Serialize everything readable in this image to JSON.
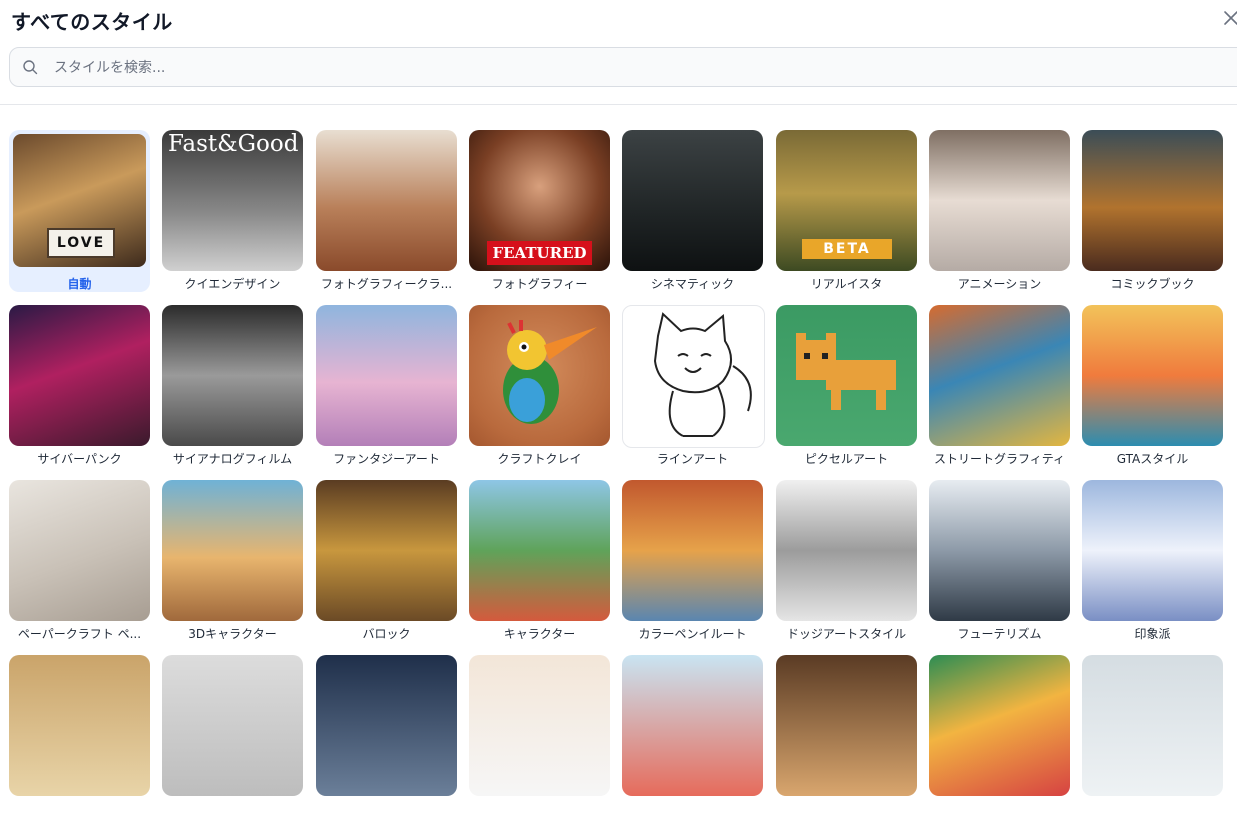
{
  "title": "すべてのスタイル",
  "search": {
    "placeholder": "スタイルを検索..."
  },
  "styles": [
    {
      "label": "自動",
      "selected": true,
      "bg": "linear-gradient(160deg,#6b4a2d 0%,#c99a5b 45%,#3d2a1c 100%)",
      "overlay": "LOVE"
    },
    {
      "label": "クイエンデザイン",
      "bg": "linear-gradient(180deg,#3a3a3a 0%,#8b8b8b 60%,#d0d0d0 100%)",
      "overlay": "Fast&Good"
    },
    {
      "label": "フォトグラフィークラ...",
      "bg": "linear-gradient(180deg,#e8ded1 0%,#b9805a 55%,#8a4a2b 100%)"
    },
    {
      "label": "フォトグラフィー",
      "bg": "radial-gradient(circle at 50% 40%,#d8a07d 0%,#7a3f24 55%,#2a1209 100%)",
      "overlay": "FEATURED"
    },
    {
      "label": "シネマティック",
      "bg": "linear-gradient(180deg,#3c4244 0%,#1f2425 60%,#0e1112 100%)"
    },
    {
      "label": "リアルイスタ",
      "bg": "linear-gradient(180deg,#7a6a36 0%,#b79a4a 45%,#3d4a22 100%)",
      "overlay": "BETA"
    },
    {
      "label": "アニメーション",
      "bg": "linear-gradient(180deg,#7f6f63 0%,#e7dcd3 50%,#b5aba5 100%)"
    },
    {
      "label": "コミックブック",
      "bg": "linear-gradient(180deg,#3b4d57 0%,#b1732e 55%,#4a2b1e 100%)"
    },
    {
      "label": "サイバーパンク",
      "bg": "linear-gradient(160deg,#2a1a45 0%,#b02060 45%,#3a1a2c 100%)"
    },
    {
      "label": "サイアナログフィルム",
      "bg": "linear-gradient(180deg,#2b2b2b 0%,#9a9a9a 50%,#4a4a4a 100%)"
    },
    {
      "label": "ファンタジーアート",
      "bg": "linear-gradient(180deg,#8fb5de 0%,#e7b4d2 55%,#b37fb8 100%)"
    },
    {
      "label": "クラフトクレイ",
      "bg": "radial-gradient(circle at 50% 45%,#d38c5c 0%,#b96a3d 70%,#a4572f 100%)"
    },
    {
      "label": "ラインアート",
      "bg": "#ffffff",
      "border": true
    },
    {
      "label": "ピクセルアート",
      "bg": "linear-gradient(180deg,#3b9a63 0%,#4aa86f 100%)"
    },
    {
      "label": "ストリートグラフィティ",
      "bg": "linear-gradient(160deg,#d66b2f 0%,#3a86b5 45%,#e3b640 100%)"
    },
    {
      "label": "GTAスタイル",
      "bg": "linear-gradient(180deg,#f2c35a 0%,#f07b3d 50%,#2c8db0 100%)"
    },
    {
      "label": "ペーパークラフト ペ...",
      "bg": "linear-gradient(160deg,#e9e5df 0%,#c9c1b7 55%,#a79d92 100%)"
    },
    {
      "label": "3Dキャラクター",
      "bg": "linear-gradient(180deg,#6fb2d6 0%,#e8b56e 55%,#a0693c 100%)"
    },
    {
      "label": "バロック",
      "bg": "linear-gradient(180deg,#5a3c22 0%,#c8973e 50%,#6b4a26 100%)"
    },
    {
      "label": "キャラクター",
      "bg": "linear-gradient(180deg,#8ec6e6 0%,#5fa35a 50%,#d45a3d 100%)"
    },
    {
      "label": "カラーペンイルート",
      "bg": "linear-gradient(180deg,#c1582e 0%,#e6a24a 50%,#5a86b0 100%)"
    },
    {
      "label": "ドッジアートスタイル",
      "bg": "linear-gradient(180deg,#f0f0f0 0%,#9c9c9c 50%,#e5e5e5 100%)"
    },
    {
      "label": "フューテリズム",
      "bg": "linear-gradient(180deg,#e7ecf1 0%,#8d9aa8 50%,#2f3a46 100%)"
    },
    {
      "label": "印象派",
      "bg": "linear-gradient(180deg,#9db7de 0%,#eef2fb 50%,#7a8fc4 100%)"
    },
    {
      "label": "",
      "bg": "linear-gradient(180deg,#caa46a 0%,#e8d4a8 100%)"
    },
    {
      "label": "",
      "bg": "linear-gradient(180deg,#dcdcdc 0%,#bdbdbd 100%)"
    },
    {
      "label": "",
      "bg": "linear-gradient(180deg,#1f2f4a 0%,#6b7f99 100%)"
    },
    {
      "label": "",
      "bg": "linear-gradient(180deg,#f3e6d8 0%,#f6f6f6 100%)"
    },
    {
      "label": "",
      "bg": "linear-gradient(180deg,#c9e4f2 0%,#e66b5b 100%)"
    },
    {
      "label": "",
      "bg": "linear-gradient(180deg,#5a3b24 0%,#d9a66e 100%)"
    },
    {
      "label": "",
      "bg": "linear-gradient(160deg,#2d8d53 0%,#f2b441 45%,#d64242 100%)"
    },
    {
      "label": "",
      "bg": "linear-gradient(180deg,#d5dde2 0%,#eef2f4 100%)"
    }
  ]
}
